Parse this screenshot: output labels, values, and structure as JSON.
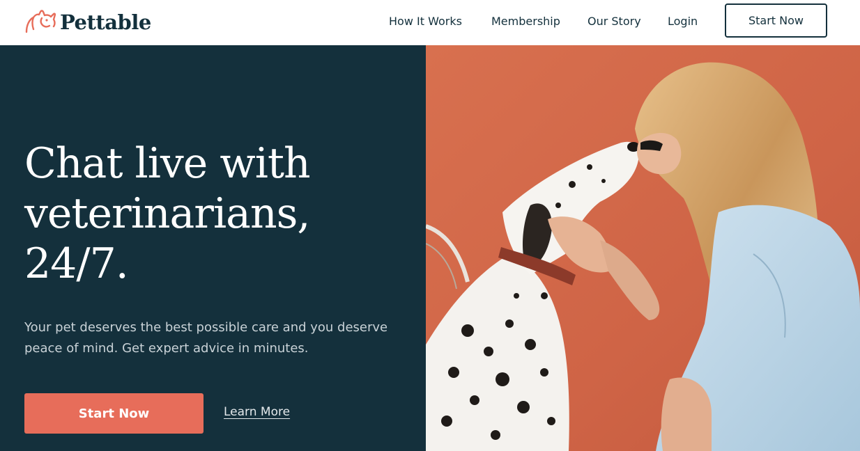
{
  "brand": {
    "name": "Pettable",
    "logo_icon": "dog-head-icon",
    "color": "#e76d5a"
  },
  "nav": {
    "links": [
      "How It Works",
      "Membership",
      "Our Story",
      "Login"
    ],
    "cta": "Start Now"
  },
  "hero": {
    "title_lines": [
      "Chat live with",
      "veterinarians,",
      "24/7."
    ],
    "subtitle_lines": [
      "Your pet deserves the best possible care and you deserve",
      "peace of mind. Get expert advice in minutes."
    ],
    "primary_cta": "Start Now",
    "secondary_cta": "Learn More",
    "image": "woman-kissing-dalmatian-photo"
  },
  "colors": {
    "navy": "#14303c",
    "coral": "#e76d5a",
    "wall": "#d66a4e",
    "white": "#ffffff"
  }
}
